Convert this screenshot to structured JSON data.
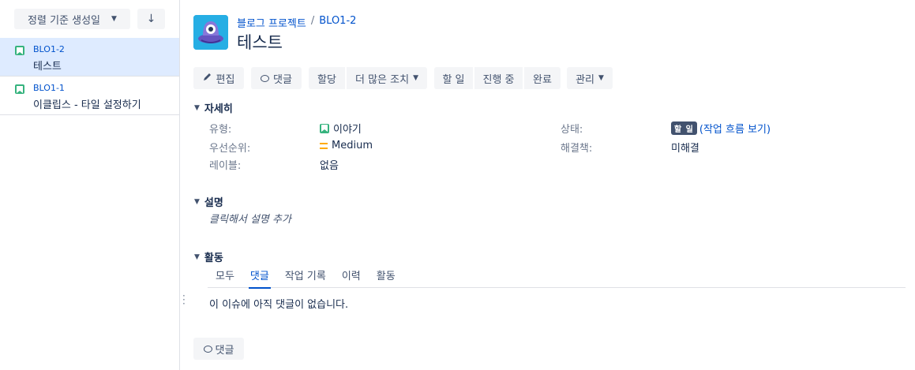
{
  "sidebar": {
    "sort_label": "정렬 기준 생성일",
    "sort_direction_icon": "arrow-down-icon",
    "issues": [
      {
        "key": "BLO1-2",
        "summary": "테스트",
        "selected": true
      },
      {
        "key": "BLO1-1",
        "summary": "이클립스 - 타일 설정하기",
        "selected": false
      }
    ]
  },
  "header": {
    "breadcrumb_project": "블로그 프로젝트",
    "breadcrumb_sep": "/",
    "breadcrumb_issue": "BLO1-2",
    "title": "테스트"
  },
  "toolbar": {
    "edit": "편집",
    "comment": "댓글",
    "assign": "할당",
    "more": "더 많은 조치",
    "todo": "할 일",
    "in_progress": "진행 중",
    "done": "완료",
    "admin": "관리"
  },
  "details": {
    "heading": "자세히",
    "type_label": "유형:",
    "type_value": "이야기",
    "priority_label": "우선순위:",
    "priority_value": "Medium",
    "labels_label": "레이블:",
    "labels_value": "없음",
    "status_label": "상태:",
    "status_value": "할 일",
    "status_link": "(작업 흐름 보기)",
    "resolution_label": "해결책:",
    "resolution_value": "미해결"
  },
  "description": {
    "heading": "설명",
    "placeholder": "클릭해서 설명 추가"
  },
  "activity": {
    "heading": "활동",
    "tabs": [
      "모두",
      "댓글",
      "작업 기록",
      "이력",
      "활동"
    ],
    "active_tab": "댓글",
    "empty_message": "이 이슈에 아직 댓글이 없습니다.",
    "comment_button": "댓글"
  },
  "colors": {
    "accent": "#0052cc",
    "story": "#36b37e",
    "priority_medium": "#ffab00",
    "status_todo": "#42526e",
    "selected_bg": "#deebff"
  }
}
